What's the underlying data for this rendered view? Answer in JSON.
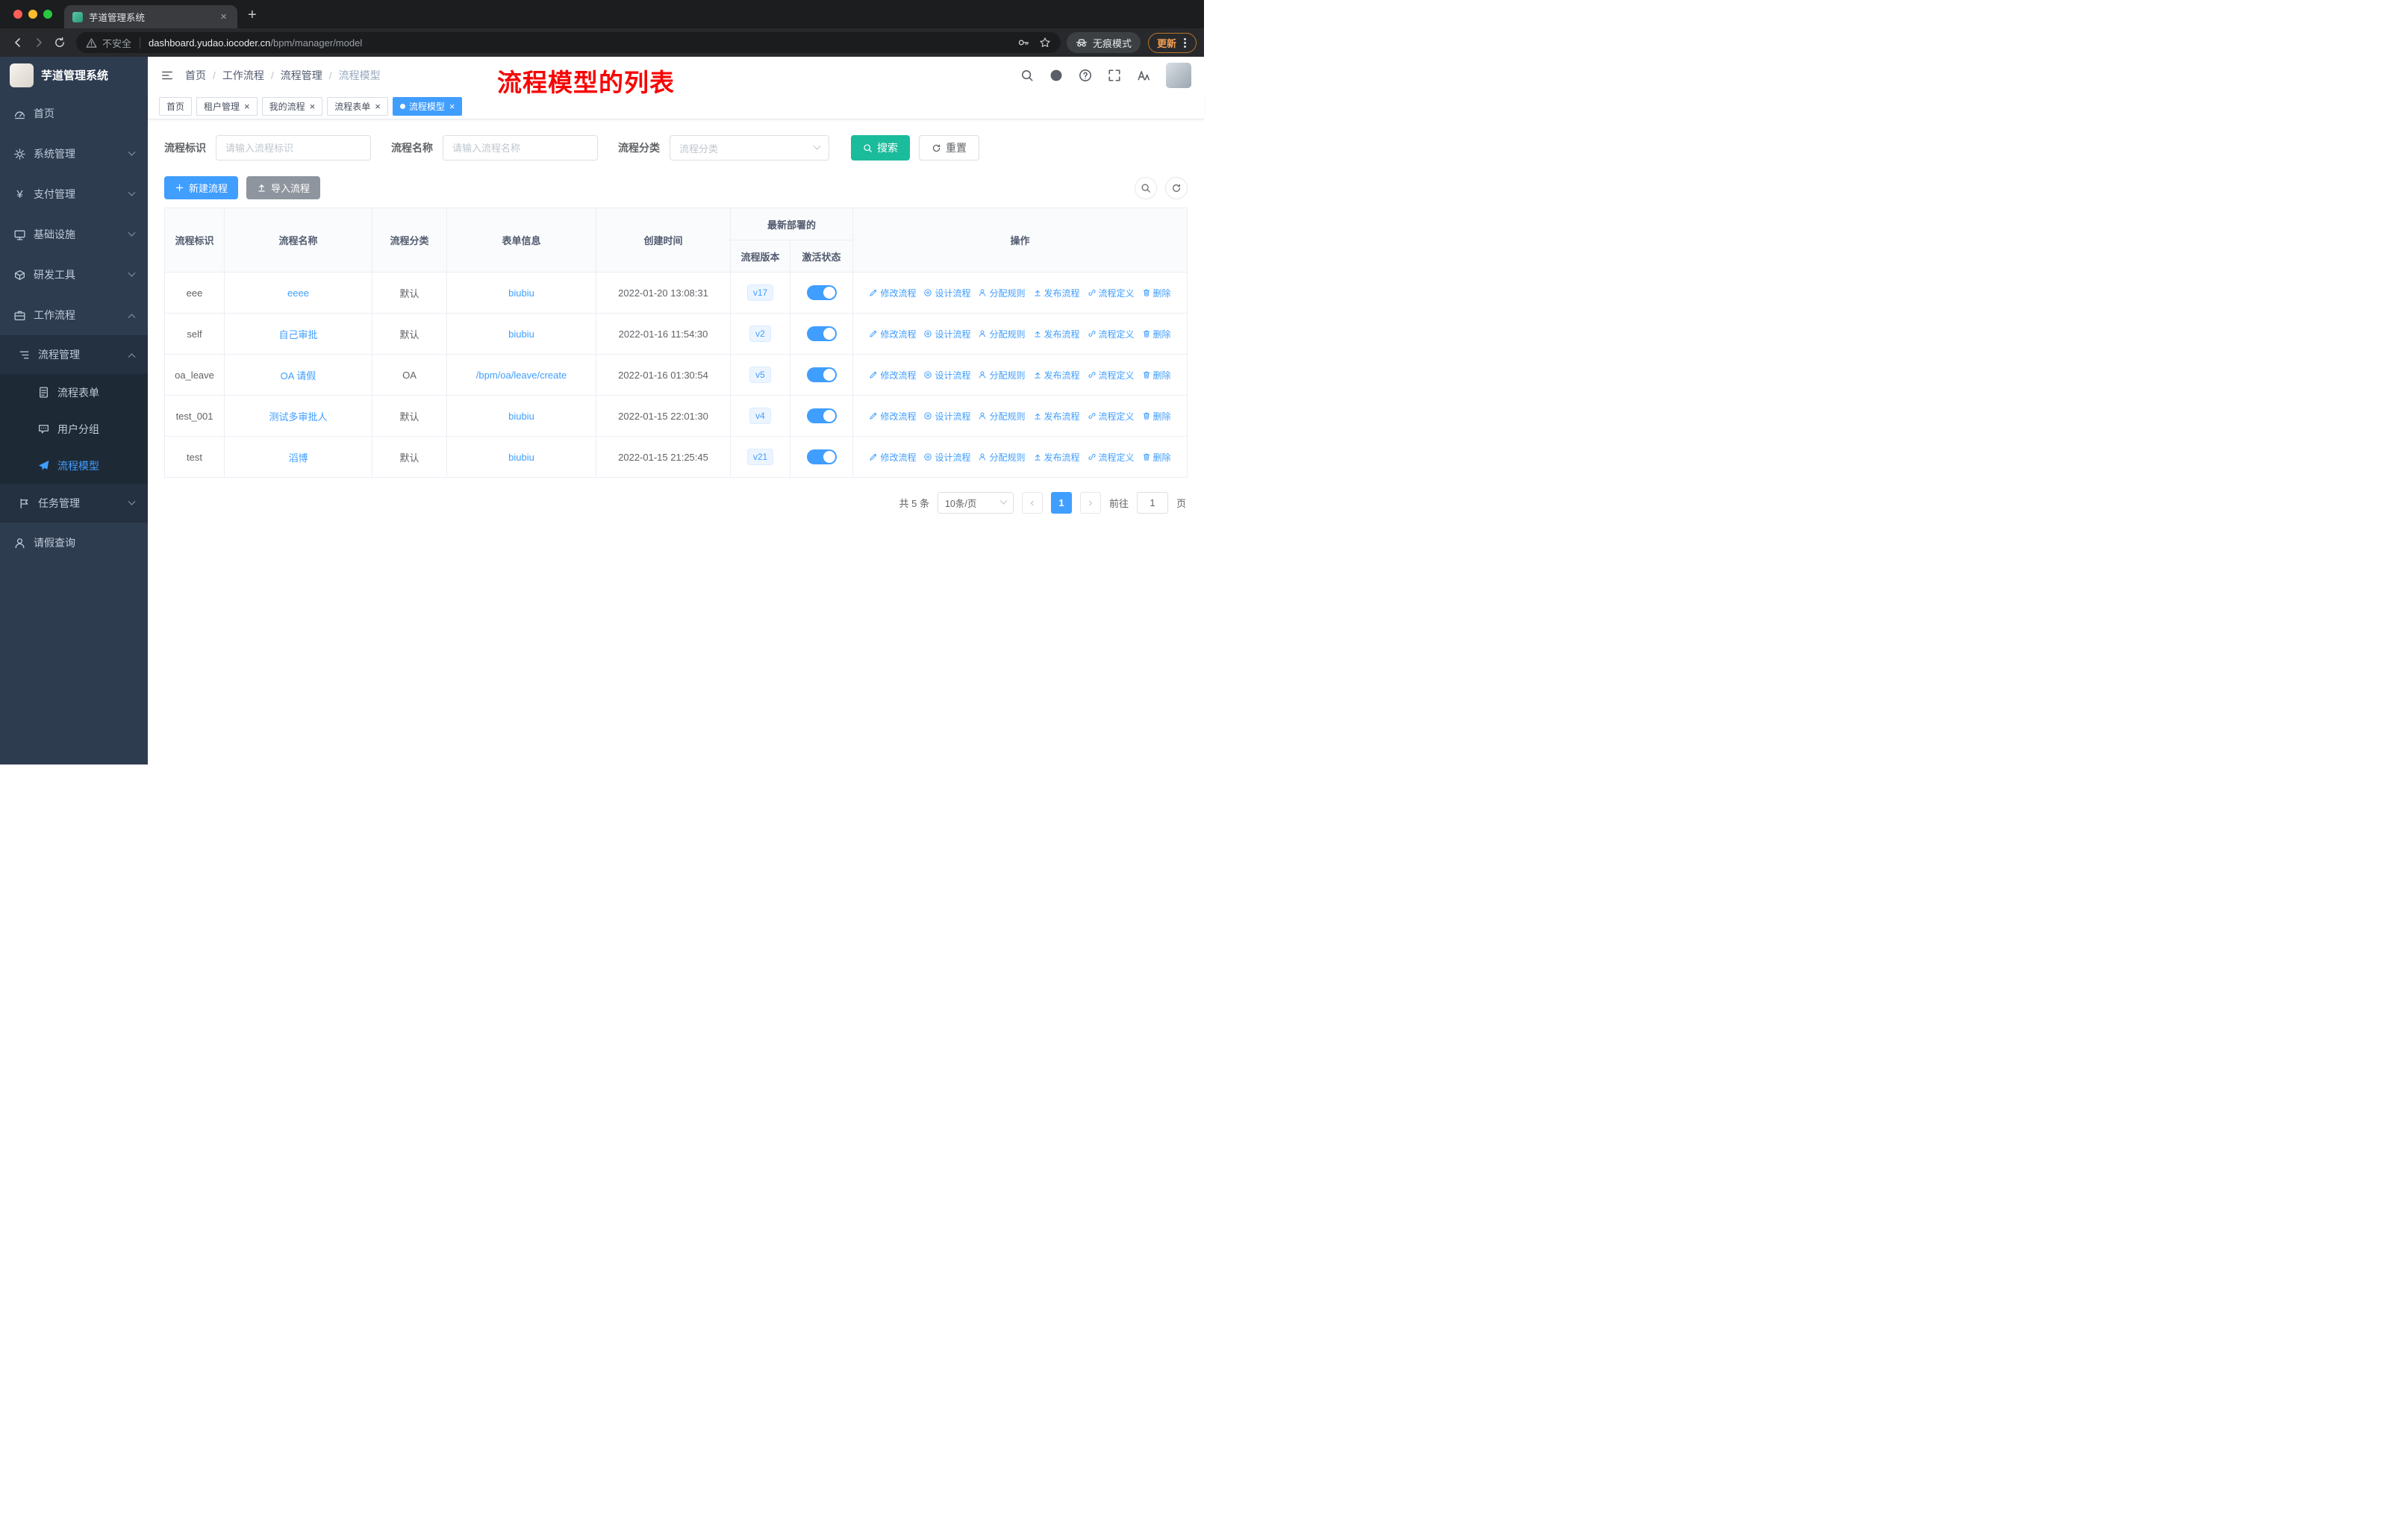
{
  "colors": {
    "primary": "#409eff",
    "success": "#1abc9c",
    "sidebar-bg": "#2e3c50",
    "annotation": "#f70505"
  },
  "browser": {
    "tab_title": "芋道管理系统",
    "security_text": "不安全",
    "url_domain": "dashboard.yudao.iocoder.cn",
    "url_path": "/bpm/manager/model",
    "incognito_label": "无痕模式",
    "update_label": "更新"
  },
  "sidebar": {
    "title": "芋道管理系统",
    "items": [
      {
        "label": "首页"
      },
      {
        "label": "系统管理"
      },
      {
        "label": "支付管理"
      },
      {
        "label": "基础设施"
      },
      {
        "label": "研发工具"
      },
      {
        "label": "工作流程"
      },
      {
        "label": "流程管理"
      },
      {
        "label": "流程表单"
      },
      {
        "label": "用户分组"
      },
      {
        "label": "流程模型"
      },
      {
        "label": "任务管理"
      },
      {
        "label": "请假查询"
      }
    ]
  },
  "navbar": {
    "breadcrumb": [
      "首页",
      "工作流程",
      "流程管理",
      "流程模型"
    ]
  },
  "annotation": "流程模型的列表",
  "tags": [
    {
      "label": "首页"
    },
    {
      "label": "租户管理"
    },
    {
      "label": "我的流程"
    },
    {
      "label": "流程表单"
    },
    {
      "label": "流程模型"
    }
  ],
  "filters": {
    "id_label": "流程标识",
    "id_placeholder": "请输入流程标识",
    "name_label": "流程名称",
    "name_placeholder": "请输入流程名称",
    "category_label": "流程分类",
    "category_placeholder": "流程分类",
    "search_label": "搜索",
    "reset_label": "重置"
  },
  "toolbar": {
    "create_label": "新建流程",
    "import_label": "导入流程"
  },
  "table": {
    "headers": {
      "id": "流程标识",
      "name": "流程名称",
      "category": "流程分类",
      "form": "表单信息",
      "created": "创建时间",
      "deploy_group": "最新部署的",
      "version": "流程版本",
      "status": "激活状态",
      "actions": "操作"
    },
    "action_labels": [
      "修改流程",
      "设计流程",
      "分配规则",
      "发布流程",
      "流程定义",
      "删除"
    ],
    "rows": [
      {
        "id": "eee",
        "name": "eeee",
        "category": "默认",
        "form": "biubiu",
        "created": "2022-01-20 13:08:31",
        "version": "v17",
        "status": "on"
      },
      {
        "id": "self",
        "name": "自己审批",
        "category": "默认",
        "form": "biubiu",
        "created": "2022-01-16 11:54:30",
        "version": "v2",
        "status": "on"
      },
      {
        "id": "oa_leave",
        "name": "OA 请假",
        "category": "OA",
        "form": "/bpm/oa/leave/create",
        "created": "2022-01-16 01:30:54",
        "version": "v5",
        "status": "on"
      },
      {
        "id": "test_001",
        "name": "测试多审批人",
        "category": "默认",
        "form": "biubiu",
        "created": "2022-01-15 22:01:30",
        "version": "v4",
        "status": "on"
      },
      {
        "id": "test",
        "name": "滔博",
        "category": "默认",
        "form": "biubiu",
        "created": "2022-01-15 21:25:45",
        "version": "v21",
        "status": "on"
      }
    ]
  },
  "pagination": {
    "total": "共 5 条",
    "page_size": "10条/页",
    "page": "1",
    "goto_label": "前往",
    "goto_value": "1",
    "unit_label": "页"
  }
}
